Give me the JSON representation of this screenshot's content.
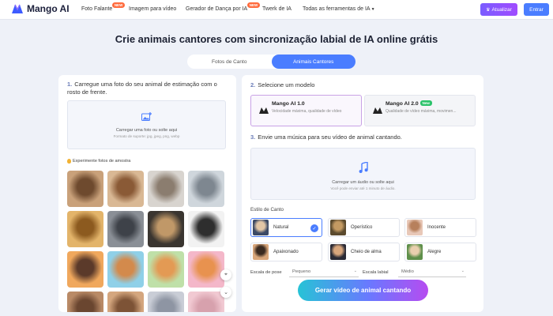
{
  "brand": {
    "name": "Mango AI"
  },
  "nav": {
    "items": [
      {
        "label": "Foto Falante",
        "badge": "NEW"
      },
      {
        "label": "Imagem para vídeo"
      },
      {
        "label": "Gerador de Dança por IA",
        "badge": "NEW"
      },
      {
        "label": "Twerk de IA"
      },
      {
        "label": "Todas as ferramentas de IA"
      }
    ],
    "upgrade_label": "Atualizar",
    "login_label": "Entrar"
  },
  "page_title": "Crie animais cantores com sincronização labial de IA online grátis",
  "tabs": [
    {
      "label": "Fotos de Canto",
      "active": false
    },
    {
      "label": "Animais Cantores",
      "active": true
    }
  ],
  "left": {
    "step_num": "1.",
    "step_text": "Carregue uma foto do seu animal de estimação com o rosto de frente.",
    "upload_main": "Carregar uma foto ou solte aqui",
    "upload_sub": "Formato de suporte: jpg, jpeg, png, webp",
    "samples_label": "Experimente fotos de amostra",
    "thumbs": [
      {
        "name": "dog-1",
        "colors": [
          "#c9a17a",
          "#6e4a2e"
        ]
      },
      {
        "name": "dog-2",
        "colors": [
          "#d9b894",
          "#8a5a36"
        ]
      },
      {
        "name": "cat-1",
        "colors": [
          "#d8d4cf",
          "#8b7d6f"
        ]
      },
      {
        "name": "cat-2",
        "colors": [
          "#cfd6dc",
          "#7e8790"
        ]
      },
      {
        "name": "lion",
        "colors": [
          "#e3b46a",
          "#8c5a1f"
        ]
      },
      {
        "name": "raccoon",
        "colors": [
          "#8a8f96",
          "#3e4249"
        ]
      },
      {
        "name": "lioness",
        "colors": [
          "#3a3530",
          "#c09868"
        ]
      },
      {
        "name": "cats-pattern",
        "colors": [
          "#f2f2f2",
          "#2e2e2e"
        ]
      },
      {
        "name": "cartoon-dog",
        "colors": [
          "#f0a85d",
          "#5b3a2a"
        ]
      },
      {
        "name": "cartoon-puppy",
        "colors": [
          "#8fd0e8",
          "#d38a4c"
        ]
      },
      {
        "name": "cartoon-cat",
        "colors": [
          "#bfe0a8",
          "#e39a54"
        ]
      },
      {
        "name": "cartoon-kitten",
        "colors": [
          "#f4b7c9",
          "#e8924f"
        ]
      },
      {
        "name": "row4-1",
        "colors": [
          "#b98a66",
          "#6a4630"
        ]
      },
      {
        "name": "row4-2",
        "colors": [
          "#d4a67e",
          "#7d5336"
        ]
      },
      {
        "name": "row4-3",
        "colors": [
          "#c9cdd6",
          "#8e95a3"
        ]
      },
      {
        "name": "row4-4",
        "colors": [
          "#f1c9d2",
          "#d7a1ad"
        ]
      }
    ]
  },
  "right": {
    "step2_num": "2.",
    "step2_text": "Selecione um modelo",
    "models": [
      {
        "name": "Mango AI 1.0",
        "desc": "Velocidade máxima, qualidade de vídeo",
        "selected": true
      },
      {
        "name": "Mango AI 2.0",
        "badge": "New",
        "desc": "Qualidade de vídeo máxima, movimen...",
        "selected": false
      }
    ],
    "step3_num": "3.",
    "step3_text": "Envie uma música para seu vídeo de animal cantando.",
    "audio_main": "Carregar um áudio ou solte aqui",
    "audio_sub": "Você pode enviar até 1 minuto de áudio.",
    "singing_label": "Estilo de Canto",
    "styles": [
      {
        "label": "Natural",
        "selected": true,
        "colors": [
          "#3c4a66",
          "#e2c6a6"
        ]
      },
      {
        "label": "Operístico",
        "selected": false,
        "colors": [
          "#5b4a2e",
          "#c49a62"
        ]
      },
      {
        "label": "Inocente",
        "selected": false,
        "colors": [
          "#e8c8b8",
          "#b7805c"
        ]
      },
      {
        "label": "Apaixonado",
        "selected": false,
        "colors": [
          "#d9a67a",
          "#3a2a20"
        ]
      },
      {
        "label": "Cheio de alma",
        "selected": false,
        "colors": [
          "#2a2a35",
          "#d8a67c"
        ]
      },
      {
        "label": "Alegre",
        "selected": false,
        "colors": [
          "#5e8f4a",
          "#e9cfae"
        ]
      }
    ],
    "pose_label": "Escala de pose",
    "pose_value": "Pequeno",
    "lip_label": "Escala labial",
    "lip_value": "Médio"
  },
  "generate_label": "Gerar vídeo de animal cantando",
  "colors": {
    "accent": "#4a7dff",
    "upgrade": "#8a55ff"
  }
}
